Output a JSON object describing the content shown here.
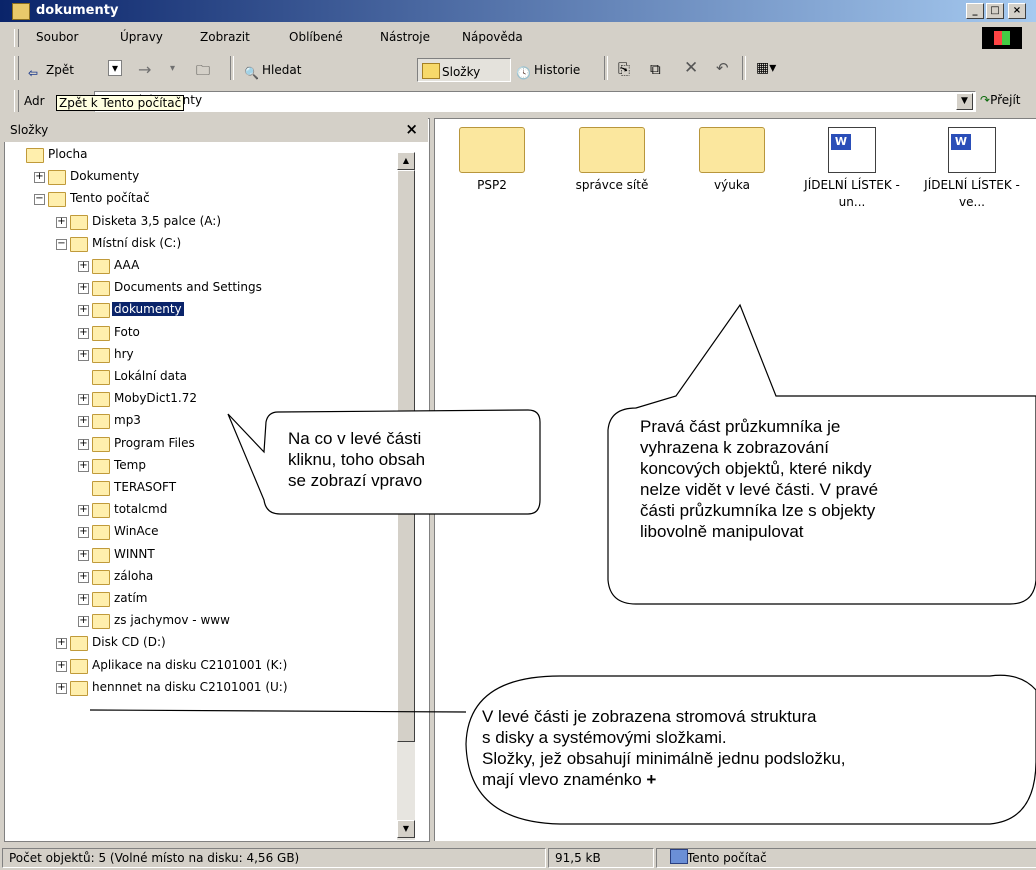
{
  "window": {
    "title": "dokumenty",
    "min": "_",
    "max": "□",
    "close": "×"
  },
  "menu": [
    "Soubor",
    "Úpravy",
    "Zobrazit",
    "Oblíbené",
    "Nástroje",
    "Nápověda"
  ],
  "toolbar": {
    "back": "Zpět",
    "search": "Hledat",
    "folders": "Složky",
    "history": "Historie"
  },
  "address": {
    "label": "Adr",
    "value": "C:\\dokumenty",
    "go": "Přejít"
  },
  "tooltip": "Zpět k Tento počítač",
  "left_panel": {
    "title": "Složky",
    "close": "×",
    "tree": [
      {
        "label": "Plocha",
        "expander": ""
      },
      {
        "label": "Dokumenty",
        "expander": "+"
      },
      {
        "label": "Tento počítač",
        "expander": "−"
      },
      {
        "label": "Disketa 3,5 palce (A:)",
        "expander": "+"
      },
      {
        "label": "Místní disk (C:)",
        "expander": "−"
      },
      {
        "label": "AAA",
        "expander": "+"
      },
      {
        "label": "Documents and Settings",
        "expander": "+"
      },
      {
        "label": "dokumenty",
        "expander": "+"
      },
      {
        "label": "Foto",
        "expander": "+"
      },
      {
        "label": "hry",
        "expander": "+"
      },
      {
        "label": "Lokální data",
        "expander": ""
      },
      {
        "label": "MobyDict1.72",
        "expander": "+"
      },
      {
        "label": "mp3",
        "expander": "+"
      },
      {
        "label": "Program Files",
        "expander": "+"
      },
      {
        "label": "Temp",
        "expander": "+"
      },
      {
        "label": "TERASOFT",
        "expander": ""
      },
      {
        "label": "totalcmd",
        "expander": "+"
      },
      {
        "label": "WinAce",
        "expander": "+"
      },
      {
        "label": "WINNT",
        "expander": "+"
      },
      {
        "label": "záloha",
        "expander": "+"
      },
      {
        "label": "zatím",
        "expander": "+"
      },
      {
        "label": "zs jachymov - www",
        "expander": "+"
      },
      {
        "label": "Disk CD (D:)",
        "expander": "+"
      },
      {
        "label": "Aplikace na disku C2101001 (K:)",
        "expander": "+"
      },
      {
        "label": "hennnet na disku C2101001 (U:)",
        "expander": "+"
      }
    ]
  },
  "right_panel": {
    "items": [
      {
        "label": "PSP2",
        "kind": "folder"
      },
      {
        "label": "správce sítě",
        "kind": "folder"
      },
      {
        "label": "výuka",
        "kind": "folder"
      },
      {
        "label": "JÍDELNÍ LÍSTEK - un...",
        "kind": "word"
      },
      {
        "label": "JÍDELNÍ LÍSTEK - ve...",
        "kind": "word"
      }
    ]
  },
  "status": {
    "count": "Počet objektů: 5 (Volné místo na disku: 4,56 GB)",
    "size": "91,5 kB",
    "location": "Tento počítač"
  },
  "annotations": {
    "a1": [
      "Na co v levé části",
      "kliknu, toho obsah",
      "se zobrazí vpravo"
    ],
    "a2": [
      "Pravá část průzkumníka je",
      "vyhrazena k zobrazování",
      "koncových objektů, které nikdy",
      "nelze vidět v levé části. V pravé",
      "části průzkumníka lze s objekty",
      "libovolně manipulovat"
    ],
    "a3": [
      "V levé části je zobrazena stromová struktura",
      "s disky a systémovými složkami.",
      "Složky, jež obsahují minimálně jednu podsložku,",
      "mají vlevo znaménko",
      "+"
    ]
  }
}
